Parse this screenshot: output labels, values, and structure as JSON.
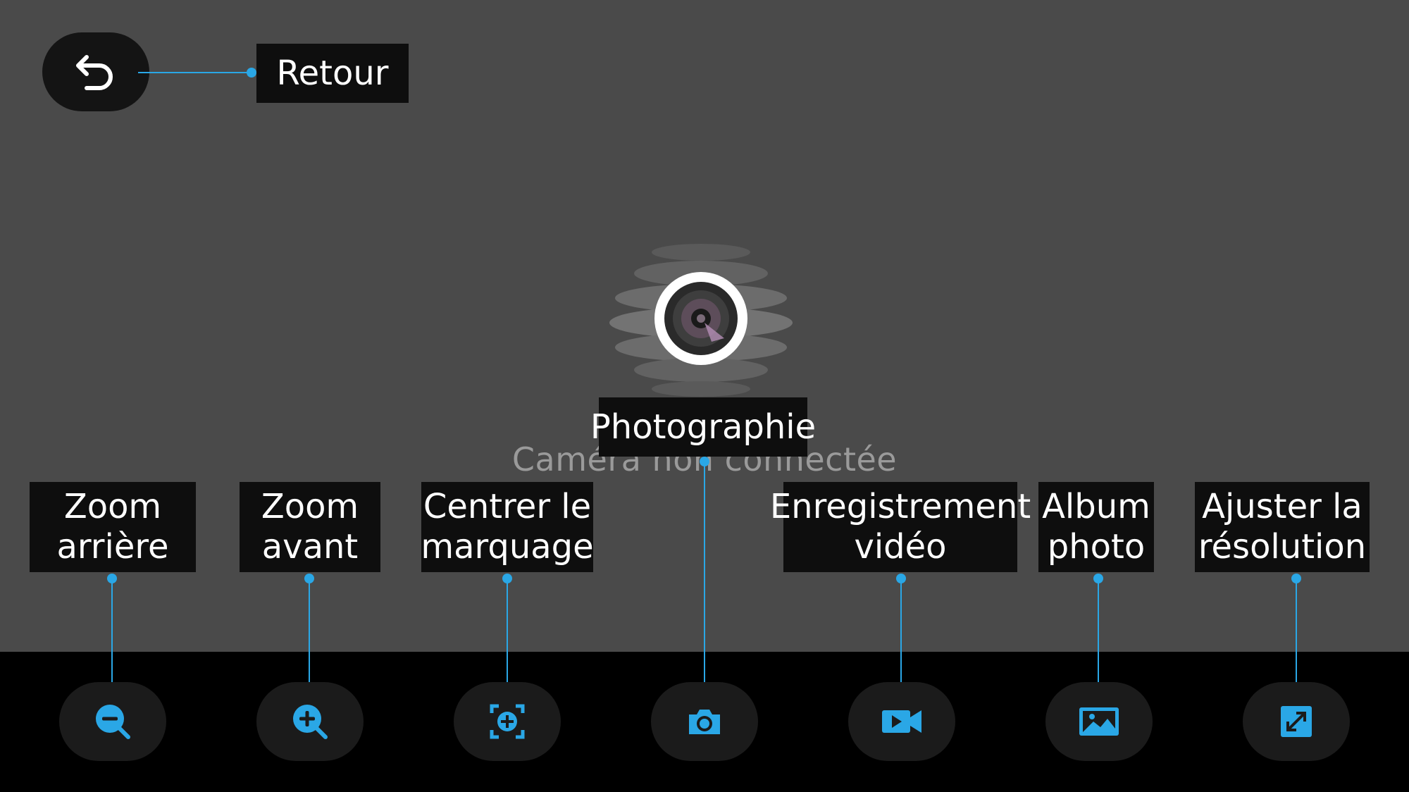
{
  "header": {
    "back_label": "Retour"
  },
  "preview": {
    "status": "Caméra non connectée"
  },
  "toolbar": {
    "items": [
      {
        "label": "Zoom\narrière",
        "icon": "zoom-out-icon"
      },
      {
        "label": "Zoom\navant",
        "icon": "zoom-in-icon"
      },
      {
        "label": "Centrer le\nmarquage",
        "icon": "center-crosshair-icon"
      },
      {
        "label": "Photographie",
        "icon": "camera-icon"
      },
      {
        "label": "Enregistrement\nvidéo",
        "icon": "video-record-icon"
      },
      {
        "label": "Album\nphoto",
        "icon": "photo-album-icon"
      },
      {
        "label": "Ajuster la\nrésolution",
        "icon": "resize-icon"
      }
    ]
  },
  "colors": {
    "accent": "#2aa7e6",
    "background": "#4a4a4a",
    "toolbar": "#000000",
    "label_bg": "#0e0e0e"
  }
}
